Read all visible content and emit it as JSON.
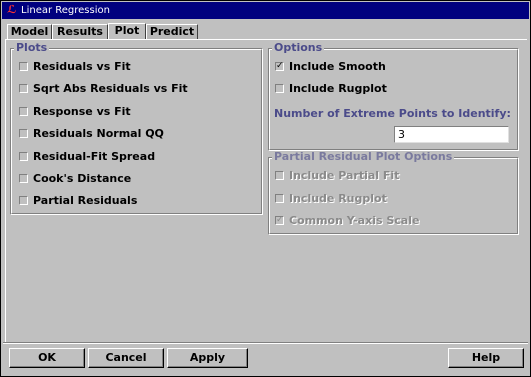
{
  "window": {
    "title": "Linear Regression"
  },
  "tabs": [
    {
      "label": "Model"
    },
    {
      "label": "Results"
    },
    {
      "label": "Plot"
    },
    {
      "label": "Predict"
    }
  ],
  "active_tab": "Plot",
  "plots": {
    "legend": "Plots",
    "items": [
      {
        "label": "Residuals vs Fit",
        "checked": false
      },
      {
        "label": "Sqrt Abs Residuals vs Fit",
        "checked": false
      },
      {
        "label": "Response vs Fit",
        "checked": false
      },
      {
        "label": "Residuals Normal QQ",
        "checked": false
      },
      {
        "label": "Residual-Fit Spread",
        "checked": false
      },
      {
        "label": "Cook's Distance",
        "checked": false
      },
      {
        "label": "Partial Residuals",
        "checked": false
      }
    ]
  },
  "options": {
    "legend": "Options",
    "include_smooth": {
      "label": "Include Smooth",
      "checked": true
    },
    "include_rugplot": {
      "label": "Include Rugplot",
      "checked": false
    },
    "extreme_points_label": "Number of Extreme Points to Identify:",
    "extreme_points_value": "3"
  },
  "partial": {
    "legend": "Partial Residual Plot Options",
    "include_partial_fit": {
      "label": "Include Partial Fit",
      "checked": false
    },
    "include_rugplot": {
      "label": "Include Rugplot",
      "checked": false
    },
    "common_y_axis": {
      "label": "Common Y-axis Scale",
      "checked": true
    }
  },
  "buttons": {
    "ok": "OK",
    "cancel": "Cancel",
    "apply": "Apply",
    "help": "Help"
  },
  "icons": {
    "app": "app-icon",
    "check": "checkmark-icon"
  }
}
